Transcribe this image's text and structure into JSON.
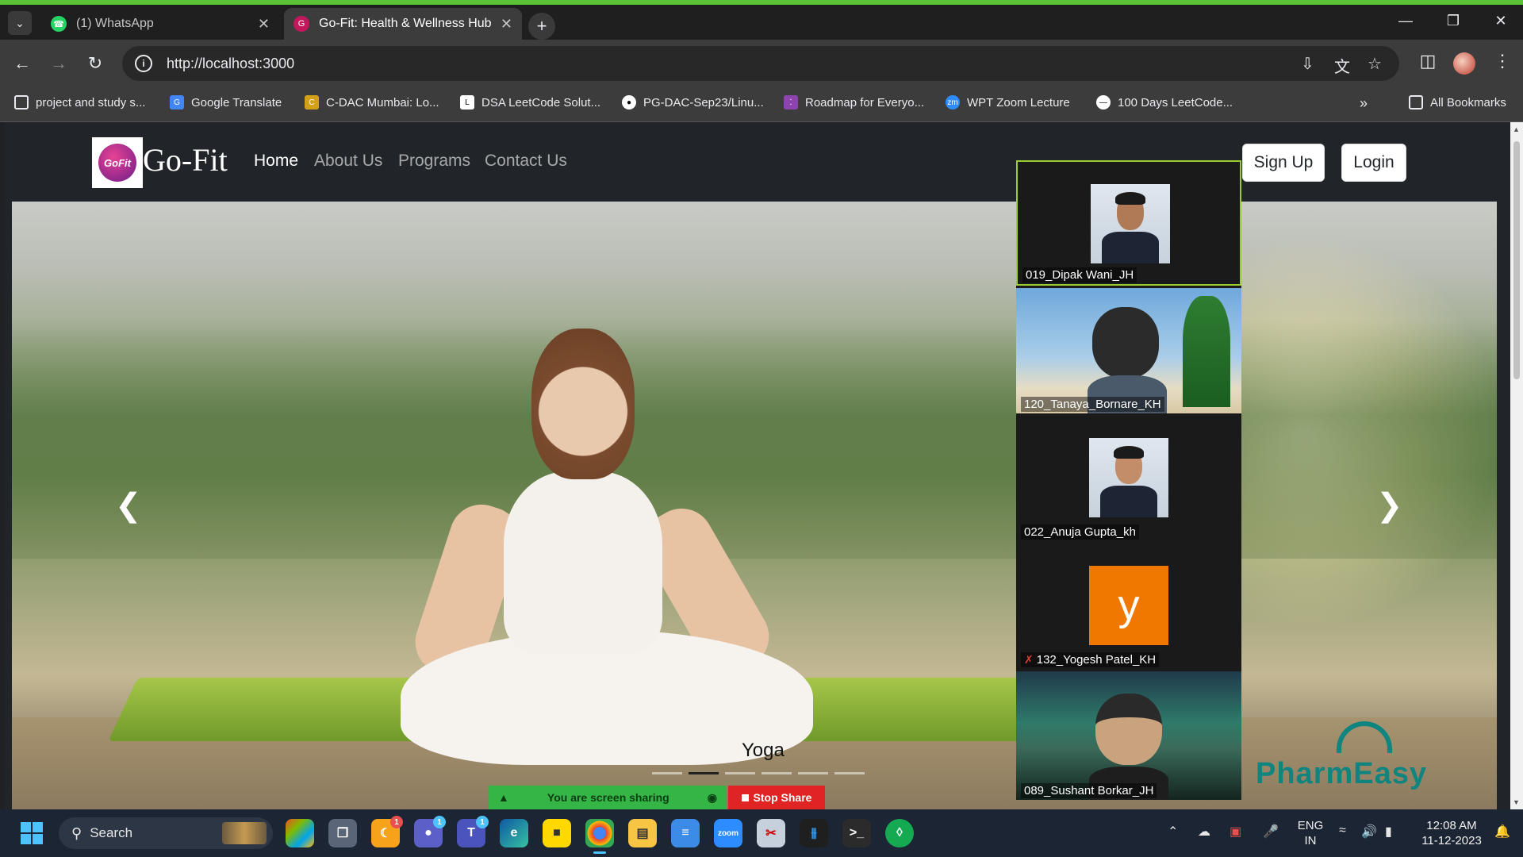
{
  "browser": {
    "tabs": [
      {
        "title": "(1) WhatsApp",
        "icon": "whatsapp-icon"
      },
      {
        "title": "Go-Fit: Health & Wellness Hub",
        "icon": "gofit-icon"
      }
    ],
    "url": "http://localhost:3000",
    "bookmarks": [
      {
        "label": "project and study s...",
        "icon": "folder-icon"
      },
      {
        "label": "Google Translate",
        "icon": "google-translate-icon"
      },
      {
        "label": "C-DAC Mumbai: Lo...",
        "icon": "cdac-icon"
      },
      {
        "label": "DSA LeetCode Solut...",
        "icon": "leetcode-icon"
      },
      {
        "label": "PG-DAC-Sep23/Linu...",
        "icon": "github-icon"
      },
      {
        "label": "Roadmap for Everyo...",
        "icon": "roadmap-icon"
      },
      {
        "label": "WPT Zoom Lecture",
        "icon": "zoom-icon"
      },
      {
        "label": "100 Days LeetCode...",
        "icon": "leetcode-icon"
      }
    ],
    "all_bookmarks": "All Bookmarks"
  },
  "site": {
    "logo_text": "GoFit",
    "brand": "Go-Fit",
    "nav": [
      "Home",
      "About Us",
      "Programs",
      "Contact Us"
    ],
    "signup": "Sign Up",
    "login": "Login",
    "carousel": {
      "caption": "Yoga",
      "slide_count": 6,
      "active_index": 1,
      "prev_icon": "chevron-left-icon",
      "next_icon": "chevron-right-icon"
    },
    "watermark": "PharmEasy"
  },
  "zoom": {
    "participants": [
      {
        "name": "019_Dipak Wani_JH",
        "speaking": true
      },
      {
        "name": "120_Tanaya_Bornare_KH"
      },
      {
        "name": "022_Anuja Gupta_kh"
      },
      {
        "name": "132_Yogesh Patel_KH",
        "avatar_letter": "y",
        "muted": true
      },
      {
        "name": "089_Sushant Borkar_JH"
      }
    ],
    "sharing_label": "You are screen sharing",
    "stop_share": "Stop Share"
  },
  "taskbar": {
    "search": "Search",
    "lang": "ENG",
    "region": "IN",
    "time": "12:08 AM",
    "date": "11-12-2023",
    "badges": {
      "teams": "1",
      "chat": "1",
      "app": "1"
    }
  },
  "colors": {
    "accent_green": "#5bc236",
    "share_green": "#35b546",
    "stop_red": "#e02424",
    "site_dark": "#212529"
  }
}
